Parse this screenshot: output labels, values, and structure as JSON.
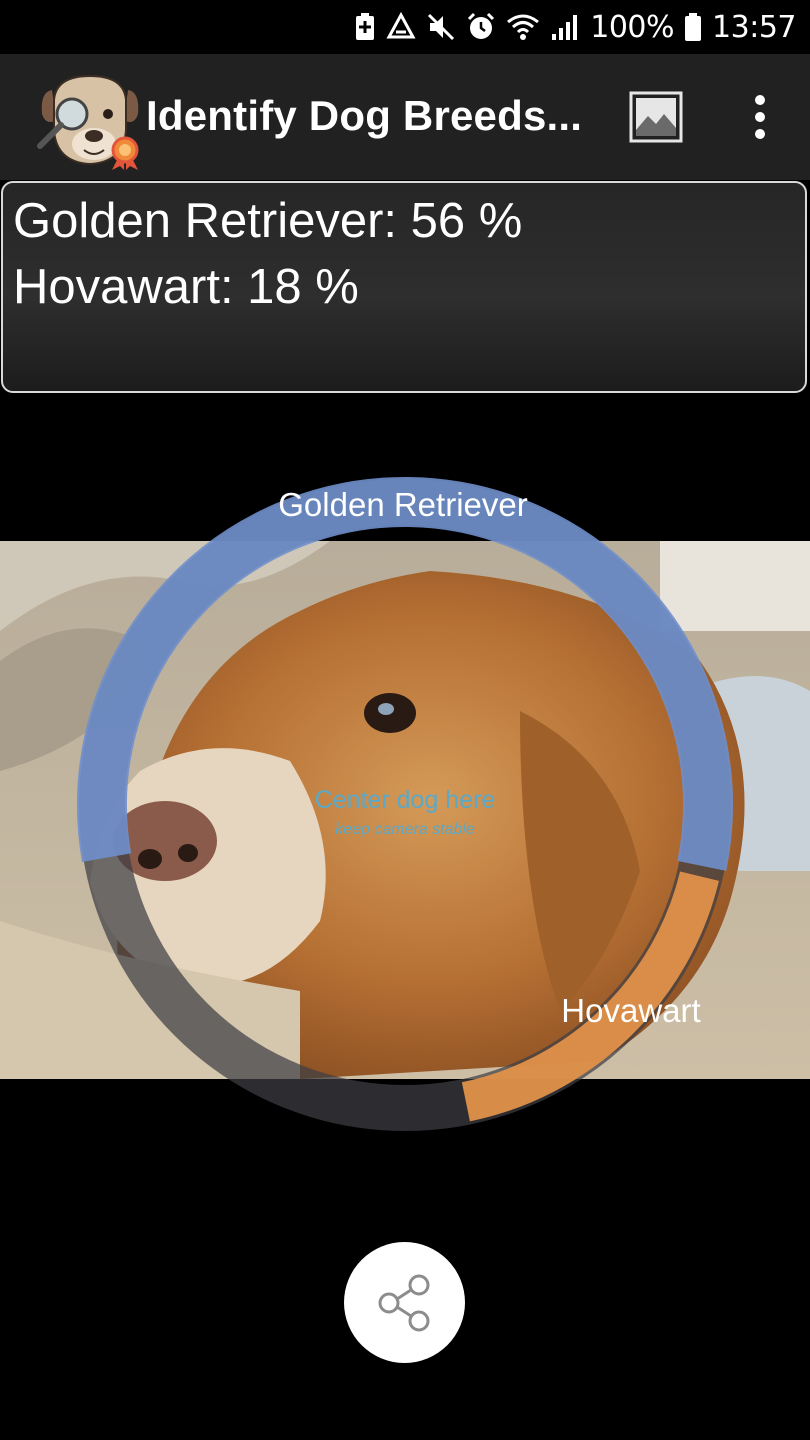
{
  "status_bar": {
    "battery": "100%",
    "time": "13:57"
  },
  "app_bar": {
    "title": "Identify Dog Breeds...",
    "logo_icon": "dog-magnifier-award-icon",
    "gallery_icon": "image-gallery-icon",
    "menu_icon": "more-vert-icon"
  },
  "results": [
    {
      "text": "Golden Retriever: 56 %"
    },
    {
      "text": "Hovawart: 18 %"
    }
  ],
  "ring": {
    "labels": {
      "primary": "Golden Retriever",
      "secondary": "Hovawart"
    },
    "primary_share": 0.56,
    "secondary_share": 0.18,
    "primary_color": "#6f8fcb",
    "secondary_color": "#e0914a"
  },
  "hint": {
    "title": "Center dog here",
    "subtitle": "keep camera stable"
  },
  "share": {
    "icon": "share-icon"
  }
}
